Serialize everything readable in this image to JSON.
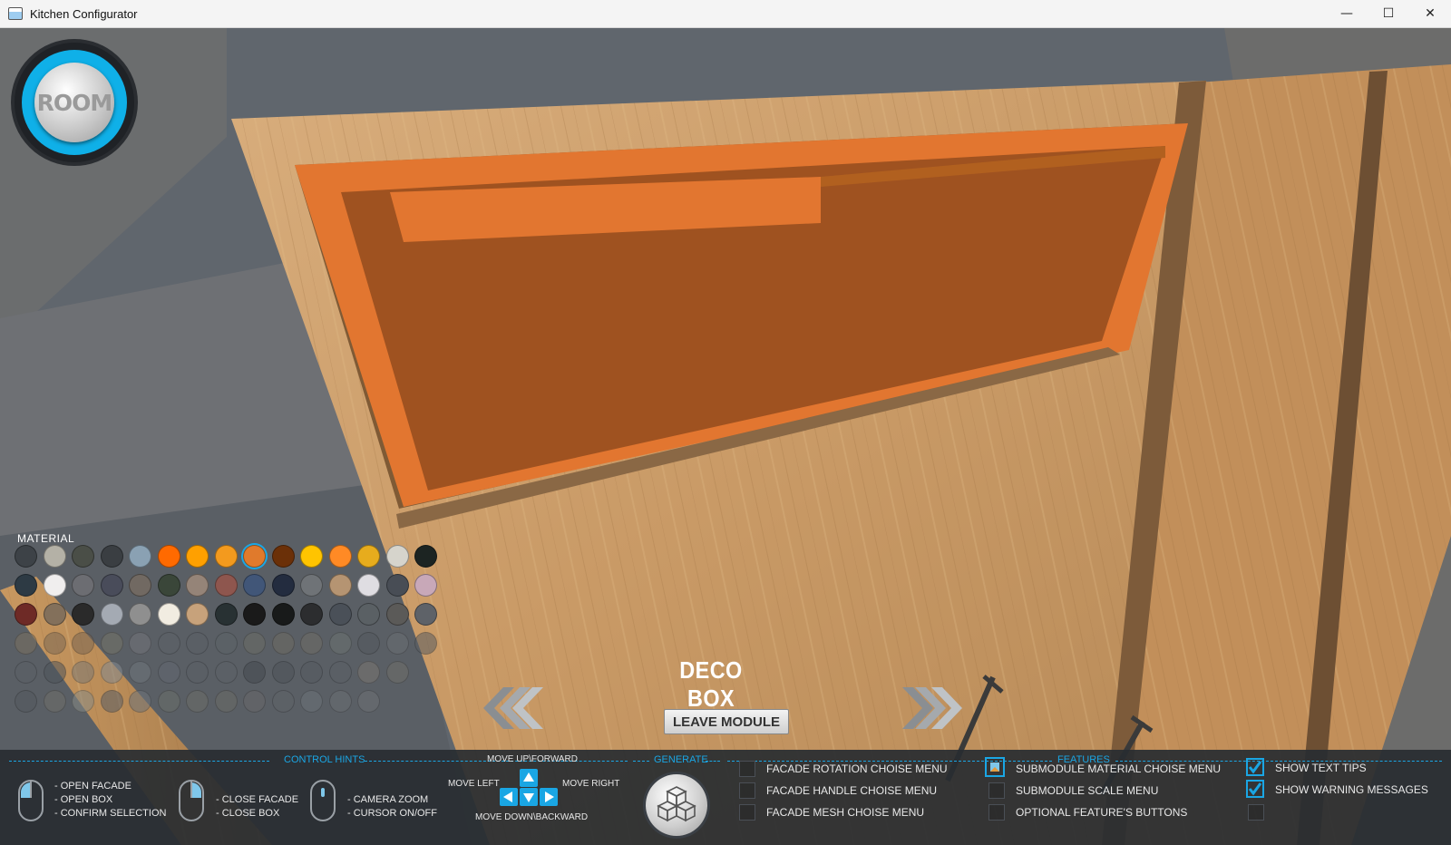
{
  "window": {
    "title": "Kitchen Configurator",
    "minimize": "—",
    "maximize": "☐",
    "close": "✕"
  },
  "room_button": {
    "label": "ROOM"
  },
  "material": {
    "label": "MATERIAL",
    "rows": [
      [
        "#3d4247",
        "#b4b1a6",
        "#4a4e47",
        "#3a3e42",
        "#8aa1b3",
        "#ff6a00",
        "#ffa000",
        "#f39a1e",
        "#e07a2c",
        "#6b3008",
        "#ffc400",
        "#ff8a25",
        "#e7ac1d",
        "#d6d4cc",
        "#1c2422"
      ],
      [
        "#2d3a44",
        "#f0eeee",
        "#6c6d72",
        "#494c5a",
        "#716962",
        "#3a4639",
        "#958478",
        "#8e564e",
        "#415678",
        "#232c3f",
        "#6f7377",
        "#b59472",
        "#dfdde2",
        "#484d55",
        "#c8a8b8"
      ],
      [
        "#6e2a26",
        "#83705b",
        "#2a2a2a",
        "#a4aab3",
        "#8f8f8f",
        "#f1ece1",
        "#c7a27b",
        "#283133",
        "#1a1a1a",
        "#181a1a",
        "#2c2d2f",
        "#4a5058",
        "#5a6064",
        "#5b5a58",
        "#5e6268"
      ],
      [
        "#7a7060",
        "#7d6a55",
        "#7c6853",
        "#757368",
        "#73747a",
        "#5c6167",
        "#5a5f66",
        "#5c6468",
        "#6b6c66",
        "#6d6a63",
        "#6f6c66",
        "#6b7270",
        "#53585e",
        "#6a6e72",
        "#5a5e62"
      ],
      [
        "#5b6066",
        "#4f555b",
        "#7d7a74",
        "#848a8f",
        "#6f757c",
        "#626870",
        "#5a5f66",
        "#5c6167",
        "#454a50",
        "#4e5359",
        "#555a60",
        "#5a6066",
        "#7a7570",
        "#6e6e6a",
        "#ffffff00"
      ],
      [
        "#53585e",
        "#6f6f6a",
        "#878a85",
        "#5a5f66",
        "#6e747a",
        "#6a6e6a",
        "#6c6c68",
        "#6a6a66",
        "#67676a",
        "#5f6368",
        "#6c7278",
        "#6a6e72",
        "#6d7075",
        "#ffffff00",
        "#ffffff00"
      ]
    ],
    "selected": {
      "row": 0,
      "col": 8
    }
  },
  "module": {
    "title": "DECO BOX",
    "leave_label": "LEAVE MODULE"
  },
  "control_hints": {
    "title": "CONTROL HINTS",
    "left_mouse": [
      "- OPEN FACADE",
      "- OPEN BOX",
      "- CONFIRM SELECTION"
    ],
    "right_mouse": [
      "- CLOSE FACADE",
      "- CLOSE BOX"
    ],
    "wheel_mouse": [
      "- CAMERA ZOOM",
      "- CURSOR ON/OFF"
    ],
    "move_up": "MOVE UP\\FORWARD",
    "move_left": "MOVE LEFT",
    "move_right": "MOVE RIGHT",
    "move_down": "MOVE DOWN\\BACKWARD"
  },
  "generate": {
    "title": "GENERATE"
  },
  "features": {
    "title": "FEATURES",
    "col1": [
      {
        "label": "FACADE ROTATION CHOISE MENU",
        "checked": false
      },
      {
        "label": "FACADE HANDLE CHOISE MENU",
        "checked": false
      },
      {
        "label": "FACADE MESH CHOISE MENU",
        "checked": false
      }
    ],
    "col2": [
      {
        "label": "SUBMODULE MATERIAL CHOISE MENU",
        "checked": true
      },
      {
        "label": "SUBMODULE SCALE MENU",
        "checked": false
      },
      {
        "label": "OPTIONAL FEATURE'S BUTTONS",
        "checked": false
      }
    ],
    "col3": [
      {
        "label": "SHOW TEXT TIPS",
        "checked": true
      },
      {
        "label": "SHOW WARNING MESSAGES",
        "checked": true
      },
      {
        "label": "",
        "checked": false
      }
    ]
  }
}
